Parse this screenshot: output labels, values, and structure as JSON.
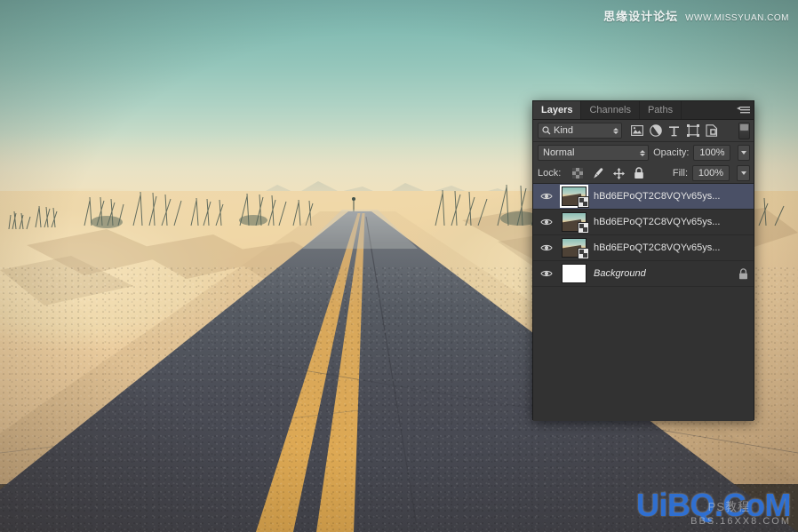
{
  "watermarks": {
    "top_cn": "思缘设计论坛",
    "top_url": "WWW.MISSYUAN.COM",
    "bottom_main": "UiBQ.CoM",
    "bottom_sub": "BBS.16XX8.COM",
    "bottom_ps": "PS教程"
  },
  "panel": {
    "tabs": [
      {
        "label": "Layers",
        "active": true,
        "name": "tab-layers"
      },
      {
        "label": "Channels",
        "active": false,
        "name": "tab-channels"
      },
      {
        "label": "Paths",
        "active": false,
        "name": "tab-paths"
      }
    ],
    "menu_icon": "panel-menu-icon",
    "filter": {
      "search_icon": "search-icon",
      "kind_label": "Kind",
      "icons": [
        {
          "name": "filter-pixel-icon",
          "title": "Pixel layers"
        },
        {
          "name": "filter-adjustment-icon",
          "title": "Adjustment layers"
        },
        {
          "name": "filter-type-icon",
          "title": "Type layers"
        },
        {
          "name": "filter-shape-icon",
          "title": "Shape layers"
        },
        {
          "name": "filter-smart-object-icon",
          "title": "Smart objects"
        }
      ],
      "toggle_name": "filter-enable-toggle"
    },
    "blend": {
      "mode": "Normal",
      "opacity_label": "Opacity:",
      "opacity_value": "100%"
    },
    "lock": {
      "label": "Lock:",
      "icons": [
        {
          "name": "lock-transparent-pixels-icon"
        },
        {
          "name": "lock-image-pixels-icon"
        },
        {
          "name": "lock-position-icon"
        },
        {
          "name": "lock-all-icon"
        }
      ],
      "fill_label": "Fill:",
      "fill_value": "100%"
    },
    "layers": [
      {
        "name": "hBd6EPoQT2C8VQYv65ys...",
        "selected": true,
        "visible": true,
        "kind": "smart-object",
        "locked": false
      },
      {
        "name": "hBd6EPoQT2C8VQYv65ys...",
        "selected": false,
        "visible": true,
        "kind": "smart-object",
        "locked": false
      },
      {
        "name": "hBd6EPoQT2C8VQYv65ys...",
        "selected": false,
        "visible": true,
        "kind": "smart-object",
        "locked": false
      },
      {
        "name": "Background",
        "selected": false,
        "visible": true,
        "kind": "background",
        "locked": true
      }
    ]
  },
  "colors": {
    "panel_bg": "#323232",
    "panel_header_bg": "#3a3a3a",
    "selection": "#4a5066",
    "sky_top": "#79b2ac",
    "sky_bottom": "#f0ddb6",
    "sand": "#efd9ad",
    "asphalt": "#4a4a52",
    "road_line": "#d8a354",
    "watermark_blue": "#2f6fd0"
  }
}
